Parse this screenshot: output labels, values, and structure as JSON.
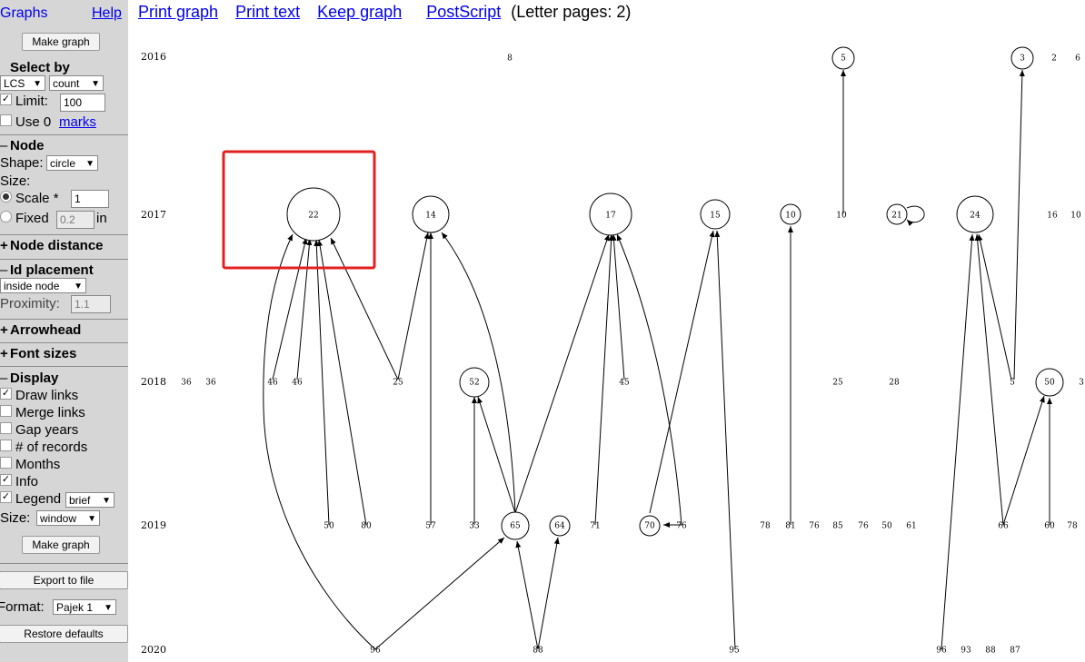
{
  "sidebar": {
    "graphs_label": "Graphs",
    "help_link": "Help",
    "make_graph_button": "Make graph",
    "select_by_heading": "Select by",
    "select_primary": "LCS",
    "select_metric": "count",
    "limit_label": "Limit:",
    "limit_value": "100",
    "use0_label": "Use 0",
    "marks_link": "marks",
    "node_section": "Node",
    "shape_label": "Shape:",
    "shape_value": "circle",
    "size_label": "Size:",
    "scale_label": "Scale *",
    "scale_value": "1",
    "fixed_label": "Fixed",
    "fixed_value": "0.2",
    "fixed_unit": "in",
    "node_distance_section": "Node distance",
    "id_placement_section": "Id placement",
    "id_placement_value": "inside node",
    "proximity_label": "Proximity:",
    "proximity_value": "1.1",
    "arrowhead_section": "Arrowhead",
    "font_sizes_section": "Font sizes",
    "display_section": "Display",
    "draw_links": "Draw links",
    "merge_links": "Merge links",
    "gap_years": "Gap years",
    "num_records": "# of records",
    "months": "Months",
    "info": "Info",
    "legend": "Legend",
    "legend_value": "brief",
    "size2_label": "Size:",
    "size2_value": "window",
    "make_graph_button2": "Make graph",
    "export_button": "Export to file",
    "format_label": "Format:",
    "format_value": "Pajek 1",
    "restore_button": "Restore defaults"
  },
  "topbar": {
    "print_graph": "Print graph",
    "print_text": "Print text",
    "keep_graph": "Keep graph",
    "postscript": "PostScript",
    "pages_note": "(Letter pages: 2)"
  },
  "years": [
    "2016",
    "2017",
    "2018",
    "2019",
    "2020"
  ],
  "nodes": [
    {
      "label": "8",
      "year": "2016",
      "big": false
    },
    {
      "label": "5",
      "year": "2016",
      "big": true
    },
    {
      "label": "3",
      "year": "2016",
      "big": true
    },
    {
      "label": "2",
      "year": "2016",
      "big": false
    },
    {
      "label": "6",
      "year": "2016",
      "big": false
    },
    {
      "label": "22",
      "year": "2017",
      "big": true
    },
    {
      "label": "14",
      "year": "2017",
      "big": true
    },
    {
      "label": "17",
      "year": "2017",
      "big": true
    },
    {
      "label": "15",
      "year": "2017",
      "big": true
    },
    {
      "label": "10",
      "year": "2017",
      "big": true
    },
    {
      "label": "10",
      "year": "2017",
      "big": false
    },
    {
      "label": "21",
      "year": "2017",
      "big": true
    },
    {
      "label": "24",
      "year": "2017",
      "big": true
    },
    {
      "label": "16",
      "year": "2017",
      "big": false
    },
    {
      "label": "10",
      "year": "2017",
      "big": false
    },
    {
      "label": "36",
      "year": "2018",
      "big": false
    },
    {
      "label": "36",
      "year": "2018",
      "big": false
    },
    {
      "label": "46",
      "year": "2018",
      "big": false
    },
    {
      "label": "46",
      "year": "2018",
      "big": false
    },
    {
      "label": "25",
      "year": "2018",
      "big": false
    },
    {
      "label": "52",
      "year": "2018",
      "big": true
    },
    {
      "label": "45",
      "year": "2018",
      "big": false
    },
    {
      "label": "25",
      "year": "2018",
      "big": false
    },
    {
      "label": "28",
      "year": "2018",
      "big": false
    },
    {
      "label": "5",
      "year": "2018",
      "big": false
    },
    {
      "label": "50",
      "year": "2018",
      "big": true
    },
    {
      "label": "3",
      "year": "2018",
      "big": false
    },
    {
      "label": "50",
      "year": "2019",
      "big": false
    },
    {
      "label": "80",
      "year": "2019",
      "big": false
    },
    {
      "label": "57",
      "year": "2019",
      "big": false
    },
    {
      "label": "33",
      "year": "2019",
      "big": false
    },
    {
      "label": "65",
      "year": "2019",
      "big": true
    },
    {
      "label": "64",
      "year": "2019",
      "big": true
    },
    {
      "label": "71",
      "year": "2019",
      "big": false
    },
    {
      "label": "70",
      "year": "2019",
      "big": true
    },
    {
      "label": "76",
      "year": "2019",
      "big": false
    },
    {
      "label": "78",
      "year": "2019",
      "big": false
    },
    {
      "label": "81",
      "year": "2019",
      "big": false
    },
    {
      "label": "76",
      "year": "2019",
      "big": false
    },
    {
      "label": "85",
      "year": "2019",
      "big": false
    },
    {
      "label": "76",
      "year": "2019",
      "big": false
    },
    {
      "label": "50",
      "year": "2019",
      "big": false
    },
    {
      "label": "61",
      "year": "2019",
      "big": false
    },
    {
      "label": "66",
      "year": "2019",
      "big": false
    },
    {
      "label": "60",
      "year": "2019",
      "big": false
    },
    {
      "label": "78",
      "year": "2019",
      "big": false
    },
    {
      "label": "96",
      "year": "2020",
      "big": false
    },
    {
      "label": "88",
      "year": "2020",
      "big": false
    },
    {
      "label": "95",
      "year": "2020",
      "big": false
    },
    {
      "label": "96",
      "year": "2020",
      "big": false
    },
    {
      "label": "93",
      "year": "2020",
      "big": false
    },
    {
      "label": "88",
      "year": "2020",
      "big": false
    },
    {
      "label": "87",
      "year": "2020",
      "big": false
    }
  ],
  "colors": {
    "highlight": "#e32020",
    "link": "#0000ee",
    "sidebar": "#d6d6d6"
  }
}
